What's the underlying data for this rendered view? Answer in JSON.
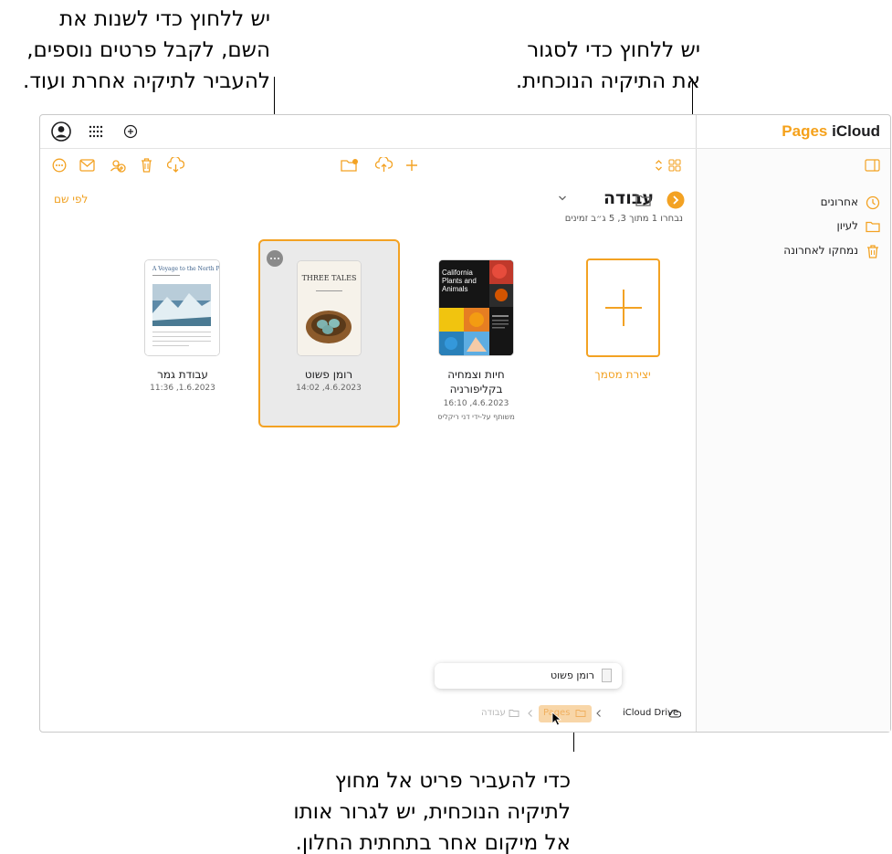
{
  "callouts": {
    "rename": [
      "יש ללחוץ כדי לשנות את",
      "השם, לקבל פרטים נוספים,",
      "להעביר לתיקיה אחרת ועוד."
    ],
    "close": [
      "יש ללחוץ כדי לסגור",
      "את התיקיה הנוכחית."
    ],
    "drag": [
      "כדי להעביר פריט אל מחוץ",
      "לתיקיה הנוכחית, יש לגרור אותו",
      "אל מיקום אחר בתחתית החלון."
    ]
  },
  "header": {
    "brand_app": "Pages",
    "brand_service": "iCloud"
  },
  "sidebar": {
    "items": [
      {
        "label": "אחרונים",
        "icon": "clock-icon"
      },
      {
        "label": "לעיון",
        "icon": "folder-icon"
      },
      {
        "label": "נמחקו לאחרונה",
        "icon": "trash-icon"
      }
    ]
  },
  "main": {
    "sort_label": "לפי שם",
    "folder_name": "עבודה",
    "selection_info": "נבחרו 1 מתוך 3, 5 ג״ב זמינים",
    "tiles": [
      {
        "name": "יצירת מסמך"
      },
      {
        "name_line1": "חיות וצמחיה",
        "name_line2": "בקליפורניה",
        "date": "4.6.2023, 16:10",
        "shared": "משותף על-ידי דני ריקליס"
      },
      {
        "name": "רומן פשוט",
        "date": "4.6.2023, 14:02"
      },
      {
        "name": "עבודת גמר",
        "date": "1.6.2023, 11:36"
      }
    ],
    "thumb_texts": {
      "nature_title": "California Plants and Animals",
      "novel_title": "THREE TALES",
      "report_title": "A Voyage to the North Pole"
    }
  },
  "drag_chip": {
    "label": "רומן פשוט"
  },
  "breadcrumb": {
    "drive": "iCloud Drive",
    "pages": "Pages",
    "work": "עבודה"
  },
  "colors": {
    "accent": "#f3a223",
    "text": "#1d1d1f",
    "selection_bg": "#eaeaea"
  }
}
